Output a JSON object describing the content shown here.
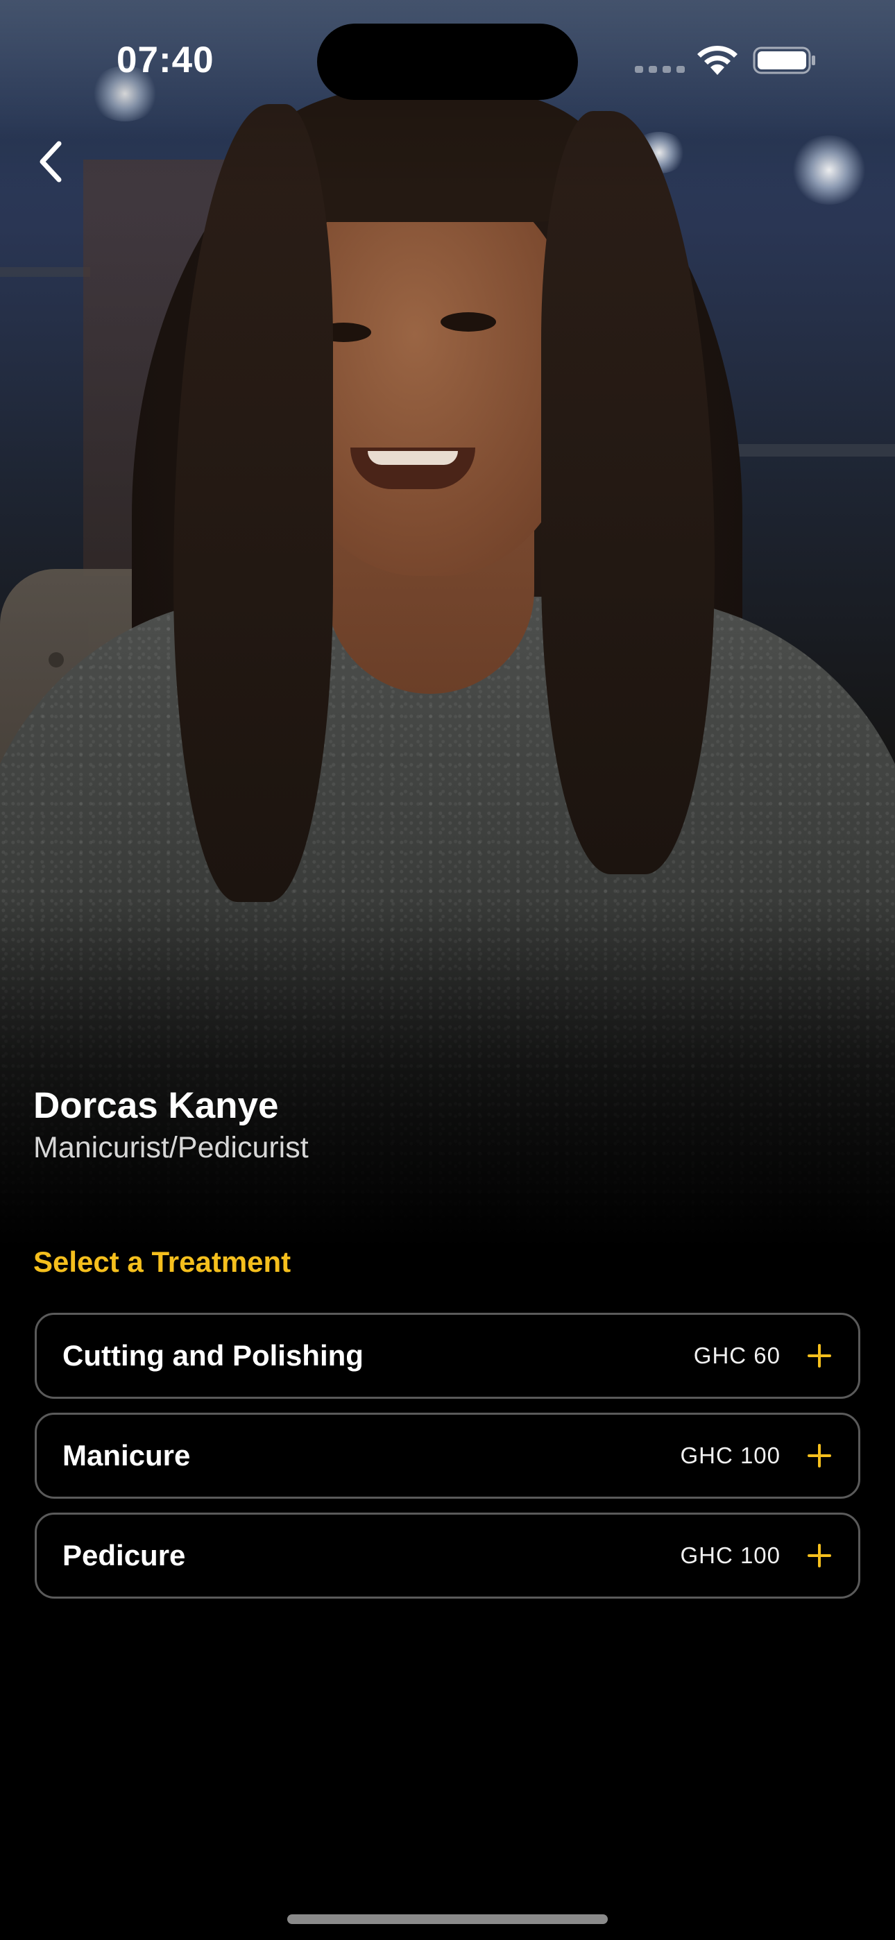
{
  "status_bar": {
    "time": "07:40",
    "icons": [
      "cellular-signal-icon",
      "wifi-icon",
      "battery-icon"
    ]
  },
  "nav": {
    "back_icon": "chevron-left-icon"
  },
  "profile": {
    "name": "Dorcas Kanye",
    "role": "Manicurist/Pedicurist"
  },
  "treatments": {
    "title": "Select a Treatment",
    "items": [
      {
        "name": "Cutting and Polishing",
        "price": "GHC 60",
        "icon": "plus-icon"
      },
      {
        "name": "Manicure",
        "price": "GHC 100",
        "icon": "plus-icon"
      },
      {
        "name": "Pedicure",
        "price": "GHC 100",
        "icon": "plus-icon"
      }
    ]
  },
  "colors": {
    "accent": "#F5BF1D",
    "background": "#000000",
    "card_border": "#5A5A5A",
    "text_primary": "#FFFFFF",
    "text_secondary": "#D7D7D7"
  }
}
